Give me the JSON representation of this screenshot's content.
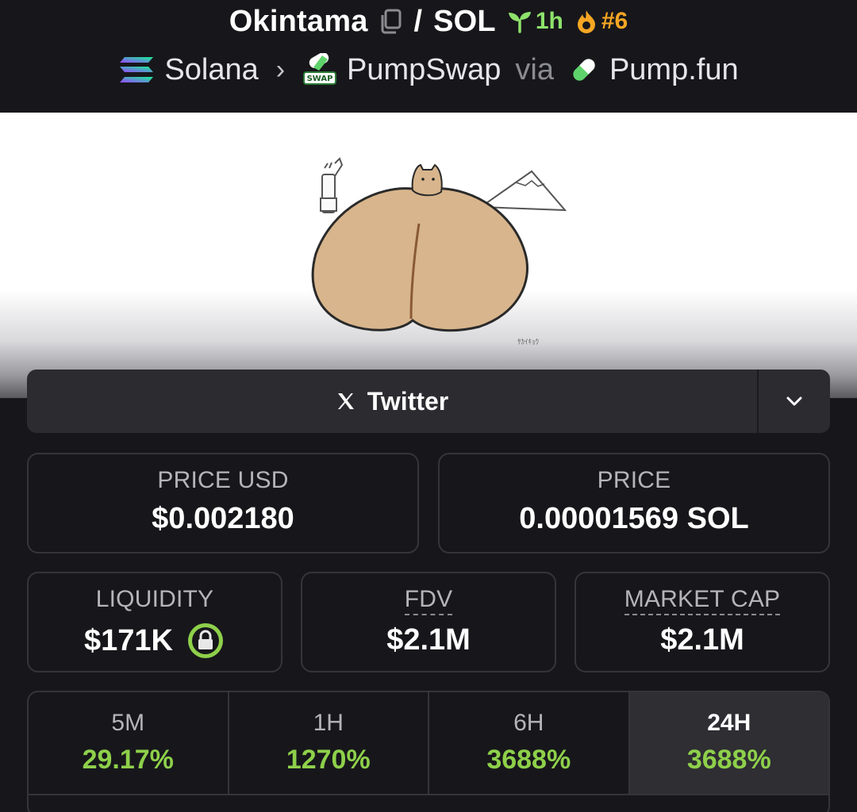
{
  "header": {
    "token_symbol": "Okintama",
    "quote_symbol": "SOL",
    "separator": "/",
    "age": "1h",
    "rank": "#6",
    "chain": "Solana",
    "dex": "PumpSwap",
    "dex_badge": "SWAP",
    "via_label": "via",
    "launchpad": "Pump.fun"
  },
  "banner": {
    "signature": "ｻｶｲｷｮｳ"
  },
  "social": {
    "twitter_label": "Twitter"
  },
  "stats": {
    "price_usd_label": "PRICE USD",
    "price_usd_value": "$0.002180",
    "price_label": "PRICE",
    "price_value": "0.00001569 SOL",
    "liquidity_label": "LIQUIDITY",
    "liquidity_value": "$171K",
    "fdv_label": "FDV",
    "fdv_value": "$2.1M",
    "mcap_label": "MARKET CAP",
    "mcap_value": "$2.1M"
  },
  "changes": [
    {
      "period": "5M",
      "value": "29.17%"
    },
    {
      "period": "1H",
      "value": "1270%"
    },
    {
      "period": "6H",
      "value": "3688%"
    },
    {
      "period": "24H",
      "value": "3688%"
    }
  ],
  "colors": {
    "positive": "#8ed04a",
    "age_green": "#8ee26b",
    "rank_orange": "#f5a623",
    "background": "#17171b",
    "card_border": "#34343a"
  }
}
